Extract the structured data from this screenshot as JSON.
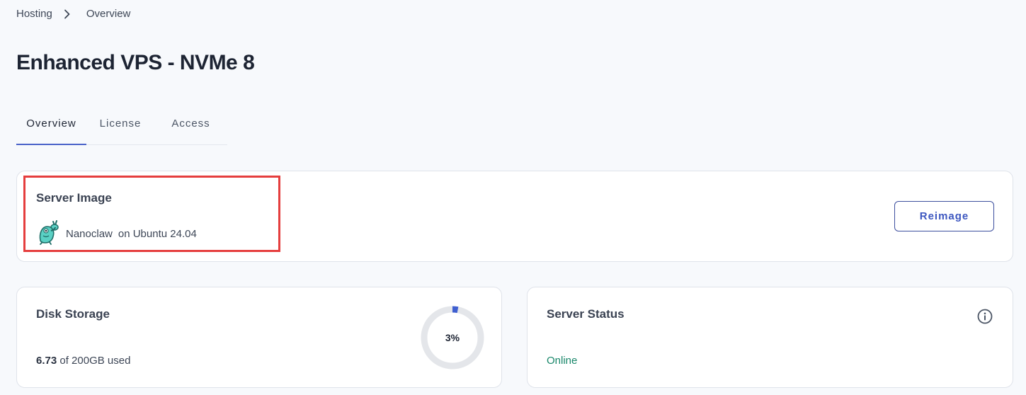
{
  "breadcrumb": {
    "parent": "Hosting",
    "current": "Overview"
  },
  "page": {
    "title": "Enhanced VPS - NVMe 8"
  },
  "tabs": [
    {
      "label": "Overview",
      "active": true
    },
    {
      "label": "License",
      "active": false
    },
    {
      "label": "Access",
      "active": false
    }
  ],
  "server_image": {
    "title": "Server Image",
    "app_name": "Nanoclaw",
    "os_text": "on Ubuntu 24.04",
    "icon": "nanoclaw-mascot-icon",
    "reimage_label": "Reimage"
  },
  "disk": {
    "title": "Disk Storage",
    "used": "6.73",
    "total_text": "of 200GB used",
    "percent": 3,
    "percent_label": "3%"
  },
  "status": {
    "title": "Server Status",
    "value": "Online",
    "icon": "info-icon"
  },
  "colors": {
    "accent": "#4a63c9",
    "online": "#19876a",
    "highlight": "#e53e3e",
    "gauge_track": "#e4e6ea",
    "gauge_fill": "#3f5fd0"
  }
}
